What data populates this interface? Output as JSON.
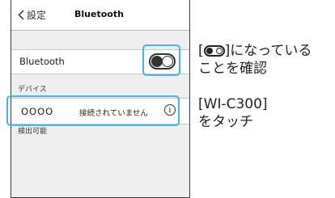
{
  "nav": {
    "back_label": "設定",
    "title": "Bluetooth"
  },
  "bluetooth_row": {
    "label": "Bluetooth",
    "toggle_state": "on"
  },
  "devices_section": {
    "header": "デバイス"
  },
  "device": {
    "name": "OOOO",
    "status": "接続されていません",
    "info_glyph": "i"
  },
  "discoverable_section": {
    "header": "検出可能"
  },
  "instructions": {
    "step1_prefix": "[",
    "step1_suffix": "]になっている",
    "step1_line2": "ことを確認",
    "step2_line1": "[WI-C300]",
    "step2_line2": "をタッチ"
  },
  "colors": {
    "highlight": "#47b6e6"
  }
}
